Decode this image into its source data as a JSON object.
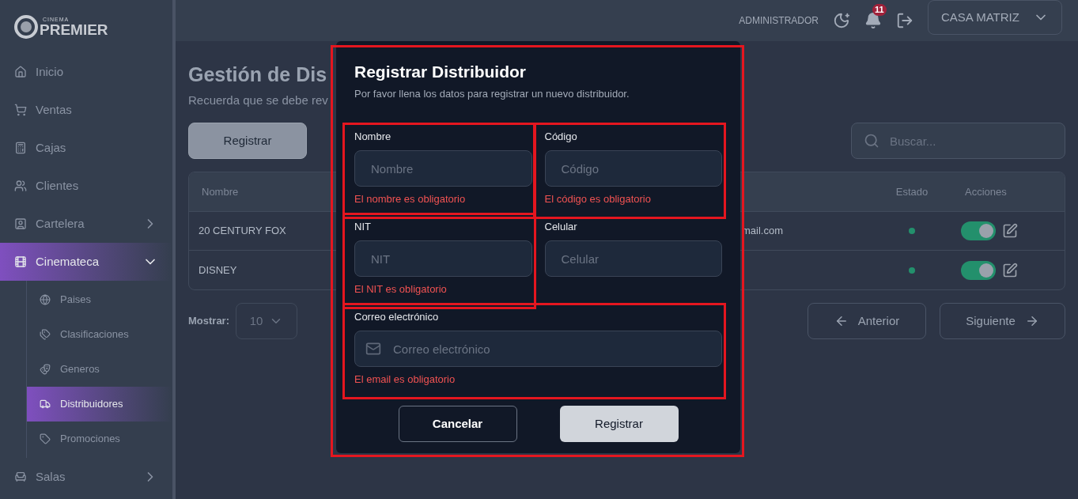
{
  "logo": {
    "small": "CINEMA",
    "name": "PREMIER"
  },
  "sidebar": {
    "items": [
      {
        "label": "Inicio",
        "selected": false
      },
      {
        "label": "Ventas",
        "selected": false
      },
      {
        "label": "Cajas",
        "selected": false
      },
      {
        "label": "Clientes",
        "selected": false
      },
      {
        "label": "Cartelera",
        "selected": false,
        "expanded": false
      },
      {
        "label": "Cinemateca",
        "selected": true,
        "expanded": true,
        "children": [
          {
            "label": "Paises",
            "selected": false
          },
          {
            "label": "Clasificaciones",
            "selected": false
          },
          {
            "label": "Generos",
            "selected": false
          },
          {
            "label": "Distribuidores",
            "selected": true
          },
          {
            "label": "Promociones",
            "selected": false
          }
        ]
      },
      {
        "label": "Salas",
        "selected": false,
        "expanded": false
      }
    ]
  },
  "topbar": {
    "user": "ADMINISTRADOR",
    "notifications": "11",
    "branch": "CASA MATRIZ"
  },
  "page": {
    "title": "Gestión de Dis",
    "subtitle": "Recuerda que se debe rev",
    "register_button": "Registrar",
    "search": {
      "placeholder": "Buscar..."
    }
  },
  "table": {
    "columns": [
      "Nombre",
      "Estado",
      "Acciones"
    ],
    "rows": [
      {
        "name": "20 CENTURY FOX",
        "column_2": "mail.com",
        "active": true,
        "on": true
      },
      {
        "name": "DISNEY",
        "active": true,
        "on": true
      }
    ]
  },
  "pagination": {
    "show_label": "Mostrar:",
    "page_size": "10",
    "previous": "Anterior",
    "next": "Siguiente"
  },
  "modal": {
    "title": "Registrar Distribuidor",
    "subtitle": "Por favor llena los datos para registrar un nuevo distribuidor.",
    "highlighted": true,
    "fields": [
      {
        "label": "Nombre",
        "placeholder": "Nombre",
        "error": "El nombre es obligatorio",
        "highlighted": true,
        "kind": "text"
      },
      {
        "label": "Código",
        "placeholder": "Código",
        "error": "El código es obligatorio",
        "highlighted": true,
        "kind": "text"
      },
      {
        "label": "NIT",
        "placeholder": "NIT",
        "error": "El NIT es obligatorio",
        "highlighted": true,
        "kind": "text"
      },
      {
        "label": "Celular",
        "placeholder": "Celular",
        "highlighted": false,
        "kind": "text"
      },
      {
        "label": "Correo electrónico",
        "placeholder": "Correo electrónico",
        "error": "El email es obligatorio",
        "highlighted": true,
        "kind": "email"
      }
    ],
    "buttons": [
      "Cancelar",
      "Registrar"
    ]
  }
}
